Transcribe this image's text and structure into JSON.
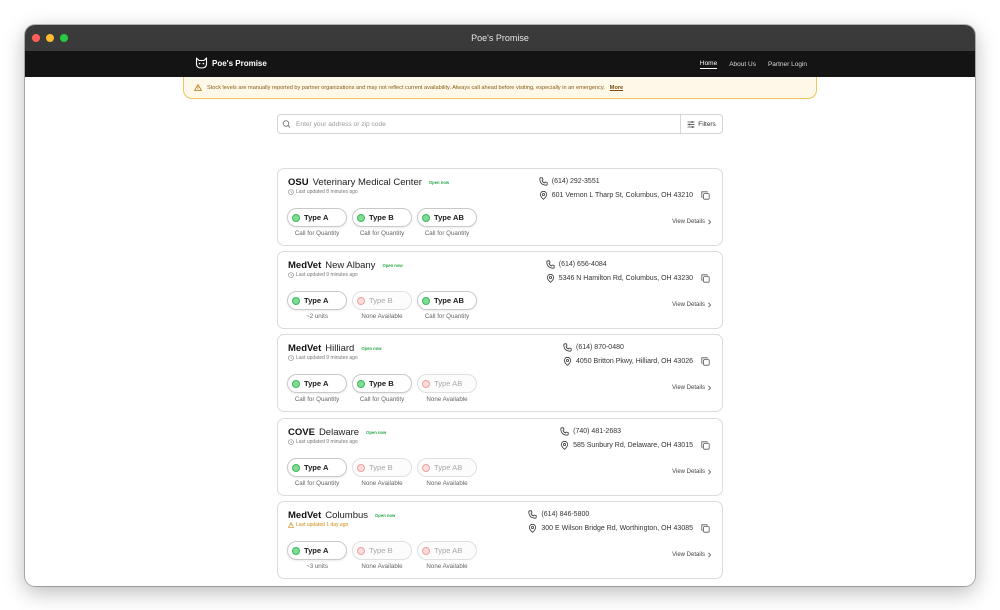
{
  "window": {
    "title": "Poe's Promise"
  },
  "nav": {
    "brand": "Poe's Promise",
    "links": [
      {
        "label": "Home",
        "active": true
      },
      {
        "label": "About Us"
      },
      {
        "label": "Partner Login"
      }
    ]
  },
  "banner": {
    "text": "Stock levels are manually reported by partner organizations and may not reflect current availability. Always call ahead before visiting, especially in an emergency.",
    "more": "More"
  },
  "search": {
    "placeholder": "Enter your address or zip code",
    "value": "",
    "filters_label": "Filters"
  },
  "colors": {
    "available": "#3cb85a",
    "unavailable": "#eea0a0",
    "open": "#2aa84a",
    "warning": "#d08a10"
  },
  "cards": [
    {
      "name_bold": "OSU",
      "name_rest": "Veterinary Medical Center",
      "status": "Open now",
      "updated": "Last updated 8 minutes ago",
      "updated_warning": false,
      "phone": "(614) 292-3551",
      "address": "601 Vernon L Tharp St, Columbus, OH 43210",
      "details": "View Details",
      "types": [
        {
          "label": "Type A",
          "available": true,
          "qty": "Call for Quantity"
        },
        {
          "label": "Type B",
          "available": true,
          "qty": "Call for Quantity"
        },
        {
          "label": "Type AB",
          "available": true,
          "qty": "Call for Quantity"
        }
      ]
    },
    {
      "name_bold": "MedVet",
      "name_rest": "New Albany",
      "status": "Open now",
      "updated": "Last updated 9 minutes ago",
      "updated_warning": false,
      "phone": "(614) 656-4084",
      "address": "5346 N Hamilton Rd, Columbus, OH 43230",
      "details": "View Details",
      "types": [
        {
          "label": "Type A",
          "available": true,
          "qty": "~2 units"
        },
        {
          "label": "Type B",
          "available": false,
          "qty": "None Available"
        },
        {
          "label": "Type AB",
          "available": true,
          "qty": "Call for Quantity"
        }
      ]
    },
    {
      "name_bold": "MedVet",
      "name_rest": "Hilliard",
      "status": "Open now",
      "updated": "Last updated 9 minutes ago",
      "updated_warning": false,
      "phone": "(614) 870-0480",
      "address": "4050 Britton Pkwy, Hilliard, OH 43026",
      "details": "View Details",
      "types": [
        {
          "label": "Type A",
          "available": true,
          "qty": "Call for Quantity"
        },
        {
          "label": "Type B",
          "available": true,
          "qty": "Call for Quantity"
        },
        {
          "label": "Type AB",
          "available": false,
          "qty": "None Available"
        }
      ]
    },
    {
      "name_bold": "COVE",
      "name_rest": "Delaware",
      "status": "Open now",
      "updated": "Last updated 9 minutes ago",
      "updated_warning": false,
      "phone": "(740) 481-2683",
      "address": "585 Sunbury Rd, Delaware, OH 43015",
      "details": "View Details",
      "types": [
        {
          "label": "Type A",
          "available": true,
          "qty": "Call for Quantity"
        },
        {
          "label": "Type B",
          "available": false,
          "qty": "None Available"
        },
        {
          "label": "Type AB",
          "available": false,
          "qty": "None Available"
        }
      ]
    },
    {
      "name_bold": "MedVet",
      "name_rest": "Columbus",
      "status": "Open now",
      "updated": "Last updated 1 day ago",
      "updated_warning": true,
      "phone": "(614) 846-5800",
      "address": "300 E Wilson Bridge Rd, Worthington, OH 43085",
      "details": "View Details",
      "types": [
        {
          "label": "Type A",
          "available": true,
          "qty": "~3 units"
        },
        {
          "label": "Type B",
          "available": false,
          "qty": "None Available"
        },
        {
          "label": "Type AB",
          "available": false,
          "qty": "None Available"
        }
      ]
    }
  ]
}
